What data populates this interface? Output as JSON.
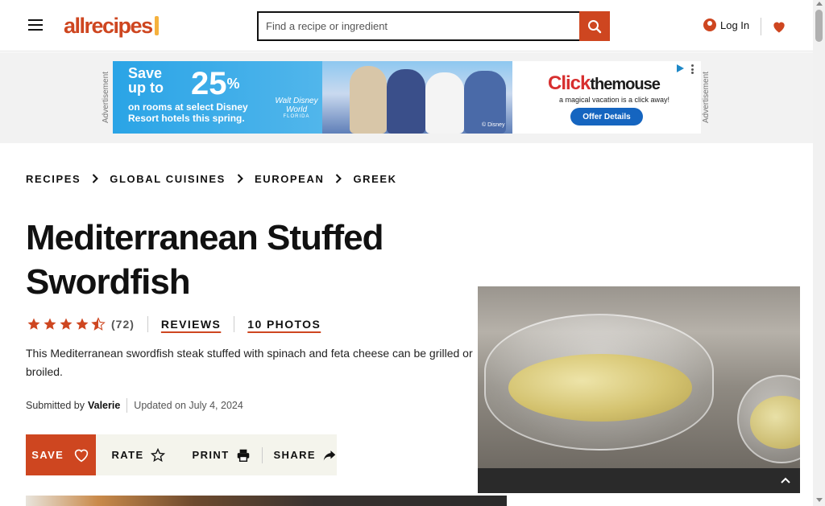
{
  "header": {
    "logo_text": "allrecipes",
    "search": {
      "placeholder": "Find a recipe or ingredient",
      "value": ""
    },
    "login_label": "Log In"
  },
  "ad": {
    "side_label": "Advertisement",
    "save_text": "Save up to",
    "discount": "25",
    "percent": "%",
    "subtext": "on rooms at select Disney Resort hotels this spring.",
    "disney_world": "Walt Disney World",
    "disney_world_sub": "FLORIDA",
    "copyright": "© Disney",
    "brand_main": "Click",
    "brand_rest": "themouse",
    "tagline": "a magical vacation is a click away!",
    "offer_label": "Offer Details"
  },
  "breadcrumb": [
    "RECIPES",
    "GLOBAL CUISINES",
    "EUROPEAN",
    "GREEK"
  ],
  "recipe": {
    "title": "Mediterranean Stuffed Swordfish",
    "rating_value": 4.5,
    "rating_count": "(72)",
    "reviews_label": "REVIEWS",
    "photos_label": "10 PHOTOS",
    "description_line1": "This Mediterranean swordfish steak stuffed with spinach and feta cheese can be grilled or",
    "description_line2": "broiled.",
    "submitted_label": "Submitted by",
    "author": "Valerie",
    "updated": "Updated on July 4, 2024"
  },
  "actions": {
    "save": "SAVE",
    "rate": "RATE",
    "print": "PRINT",
    "share": "SHARE"
  },
  "colors": {
    "brand": "#ce4620",
    "logo_accent": "#f5b13d",
    "action_bar_bg": "#f4f4ec"
  },
  "icons": {
    "menu": "hamburger-icon",
    "search": "search-icon",
    "user": "user-icon",
    "favorites": "heart-icon",
    "chevron": "chevron-right-icon",
    "star": "star-icon",
    "heart": "heart-outline-icon",
    "print": "printer-icon",
    "share": "share-icon"
  }
}
